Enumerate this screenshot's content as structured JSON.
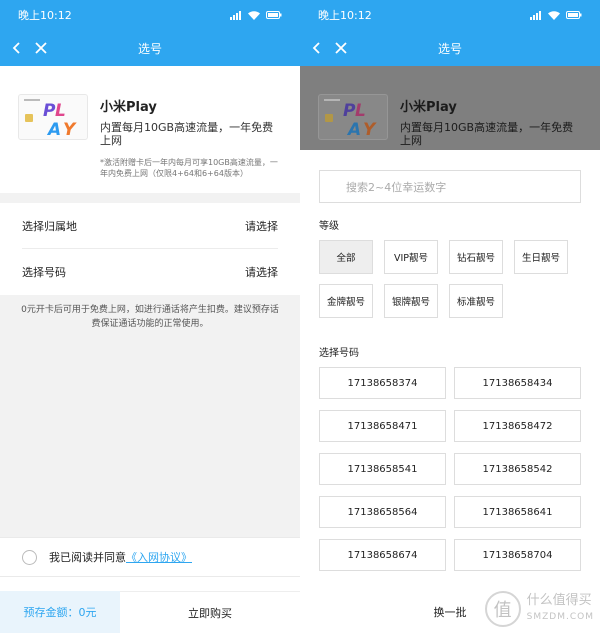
{
  "left": {
    "status_time": "晚上10:12",
    "nav_title": "选号",
    "product": {
      "name": "小米Play",
      "desc": "内置每月10GB高速流量，一年免费上网",
      "note": "*激活附赠卡后一年内每月可享10GB高速流量，一年内免费上网（仅限4+64和6+64版本）"
    },
    "rows": [
      {
        "label": "选择归属地",
        "value": "请选择"
      },
      {
        "label": "选择号码",
        "value": "请选择"
      }
    ],
    "notice": "0元开卡后可用于免费上网，如进行通话将产生扣费。建议预存话费保证通话功能的正常使用。",
    "agree_text": "我已阅读并同意",
    "agree_link": "《入网协议》",
    "amount": "预存金额：0元",
    "buy": "立即购买"
  },
  "right": {
    "status_time": "晚上10:12",
    "nav_title": "选号",
    "product": {
      "name": "小米Play",
      "desc": "内置每月10GB高速流量，一年免费上网"
    },
    "search_placeholder": "搜索2~4位幸运数字",
    "grade_label": "等级",
    "grades": [
      "全部",
      "VIP靓号",
      "钻石靓号",
      "生日靓号",
      "金牌靓号",
      "银牌靓号",
      "标准靓号"
    ],
    "numbers_label": "选择号码",
    "numbers": [
      "17138658374",
      "17138658434",
      "17138658471",
      "17138658472",
      "17138658541",
      "17138658542",
      "17138658564",
      "17138658641",
      "17138658674",
      "17138658704"
    ],
    "refresh": "换一批",
    "watermark_cn": "什么值得买",
    "watermark_en": "SMZDM.COM",
    "watermark_glyph": "值"
  },
  "colors": {
    "accent": "#2ea6f0",
    "overlay": "#7f7f7f"
  },
  "icons": [
    "back-icon",
    "close-icon",
    "signal-icon",
    "wifi-icon",
    "battery-icon"
  ]
}
